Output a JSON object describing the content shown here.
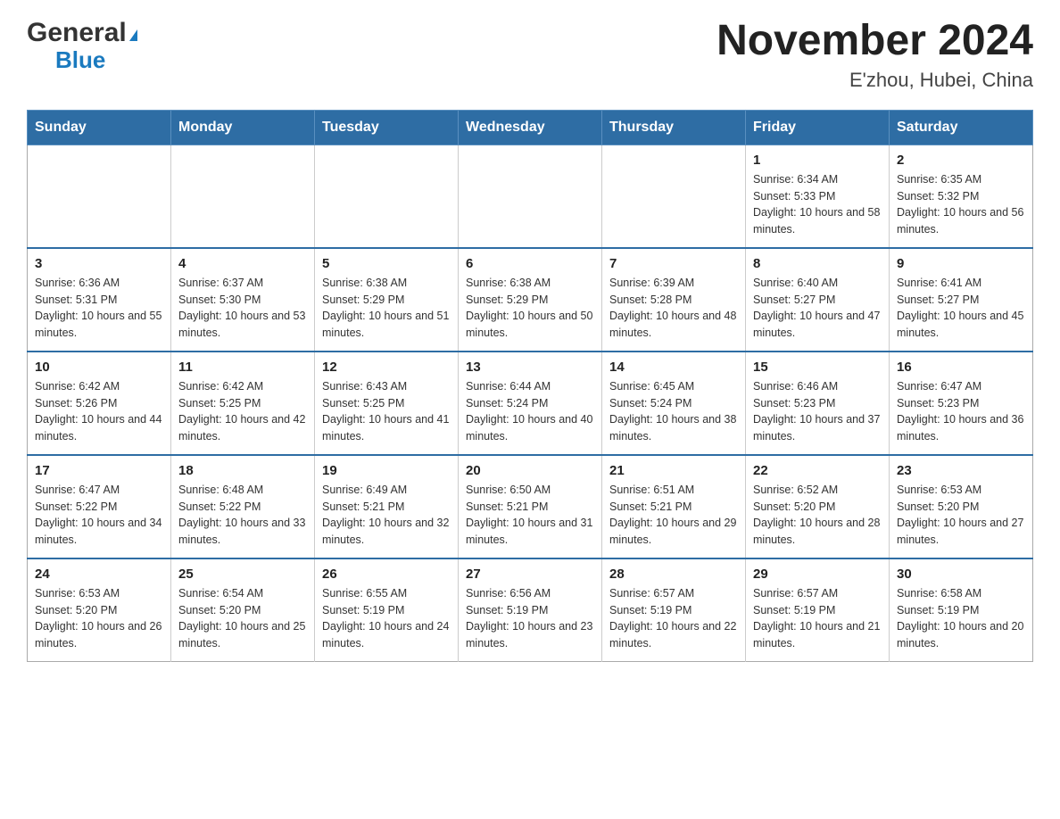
{
  "logo": {
    "general": "General",
    "triangle": "▶",
    "blue": "Blue"
  },
  "title": "November 2024",
  "subtitle": "E'zhou, Hubei, China",
  "weekdays": [
    "Sunday",
    "Monday",
    "Tuesday",
    "Wednesday",
    "Thursday",
    "Friday",
    "Saturday"
  ],
  "weeks": [
    [
      {
        "day": "",
        "info": ""
      },
      {
        "day": "",
        "info": ""
      },
      {
        "day": "",
        "info": ""
      },
      {
        "day": "",
        "info": ""
      },
      {
        "day": "",
        "info": ""
      },
      {
        "day": "1",
        "info": "Sunrise: 6:34 AM\nSunset: 5:33 PM\nDaylight: 10 hours and 58 minutes."
      },
      {
        "day": "2",
        "info": "Sunrise: 6:35 AM\nSunset: 5:32 PM\nDaylight: 10 hours and 56 minutes."
      }
    ],
    [
      {
        "day": "3",
        "info": "Sunrise: 6:36 AM\nSunset: 5:31 PM\nDaylight: 10 hours and 55 minutes."
      },
      {
        "day": "4",
        "info": "Sunrise: 6:37 AM\nSunset: 5:30 PM\nDaylight: 10 hours and 53 minutes."
      },
      {
        "day": "5",
        "info": "Sunrise: 6:38 AM\nSunset: 5:29 PM\nDaylight: 10 hours and 51 minutes."
      },
      {
        "day": "6",
        "info": "Sunrise: 6:38 AM\nSunset: 5:29 PM\nDaylight: 10 hours and 50 minutes."
      },
      {
        "day": "7",
        "info": "Sunrise: 6:39 AM\nSunset: 5:28 PM\nDaylight: 10 hours and 48 minutes."
      },
      {
        "day": "8",
        "info": "Sunrise: 6:40 AM\nSunset: 5:27 PM\nDaylight: 10 hours and 47 minutes."
      },
      {
        "day": "9",
        "info": "Sunrise: 6:41 AM\nSunset: 5:27 PM\nDaylight: 10 hours and 45 minutes."
      }
    ],
    [
      {
        "day": "10",
        "info": "Sunrise: 6:42 AM\nSunset: 5:26 PM\nDaylight: 10 hours and 44 minutes."
      },
      {
        "day": "11",
        "info": "Sunrise: 6:42 AM\nSunset: 5:25 PM\nDaylight: 10 hours and 42 minutes."
      },
      {
        "day": "12",
        "info": "Sunrise: 6:43 AM\nSunset: 5:25 PM\nDaylight: 10 hours and 41 minutes."
      },
      {
        "day": "13",
        "info": "Sunrise: 6:44 AM\nSunset: 5:24 PM\nDaylight: 10 hours and 40 minutes."
      },
      {
        "day": "14",
        "info": "Sunrise: 6:45 AM\nSunset: 5:24 PM\nDaylight: 10 hours and 38 minutes."
      },
      {
        "day": "15",
        "info": "Sunrise: 6:46 AM\nSunset: 5:23 PM\nDaylight: 10 hours and 37 minutes."
      },
      {
        "day": "16",
        "info": "Sunrise: 6:47 AM\nSunset: 5:23 PM\nDaylight: 10 hours and 36 minutes."
      }
    ],
    [
      {
        "day": "17",
        "info": "Sunrise: 6:47 AM\nSunset: 5:22 PM\nDaylight: 10 hours and 34 minutes."
      },
      {
        "day": "18",
        "info": "Sunrise: 6:48 AM\nSunset: 5:22 PM\nDaylight: 10 hours and 33 minutes."
      },
      {
        "day": "19",
        "info": "Sunrise: 6:49 AM\nSunset: 5:21 PM\nDaylight: 10 hours and 32 minutes."
      },
      {
        "day": "20",
        "info": "Sunrise: 6:50 AM\nSunset: 5:21 PM\nDaylight: 10 hours and 31 minutes."
      },
      {
        "day": "21",
        "info": "Sunrise: 6:51 AM\nSunset: 5:21 PM\nDaylight: 10 hours and 29 minutes."
      },
      {
        "day": "22",
        "info": "Sunrise: 6:52 AM\nSunset: 5:20 PM\nDaylight: 10 hours and 28 minutes."
      },
      {
        "day": "23",
        "info": "Sunrise: 6:53 AM\nSunset: 5:20 PM\nDaylight: 10 hours and 27 minutes."
      }
    ],
    [
      {
        "day": "24",
        "info": "Sunrise: 6:53 AM\nSunset: 5:20 PM\nDaylight: 10 hours and 26 minutes."
      },
      {
        "day": "25",
        "info": "Sunrise: 6:54 AM\nSunset: 5:20 PM\nDaylight: 10 hours and 25 minutes."
      },
      {
        "day": "26",
        "info": "Sunrise: 6:55 AM\nSunset: 5:19 PM\nDaylight: 10 hours and 24 minutes."
      },
      {
        "day": "27",
        "info": "Sunrise: 6:56 AM\nSunset: 5:19 PM\nDaylight: 10 hours and 23 minutes."
      },
      {
        "day": "28",
        "info": "Sunrise: 6:57 AM\nSunset: 5:19 PM\nDaylight: 10 hours and 22 minutes."
      },
      {
        "day": "29",
        "info": "Sunrise: 6:57 AM\nSunset: 5:19 PM\nDaylight: 10 hours and 21 minutes."
      },
      {
        "day": "30",
        "info": "Sunrise: 6:58 AM\nSunset: 5:19 PM\nDaylight: 10 hours and 20 minutes."
      }
    ]
  ]
}
